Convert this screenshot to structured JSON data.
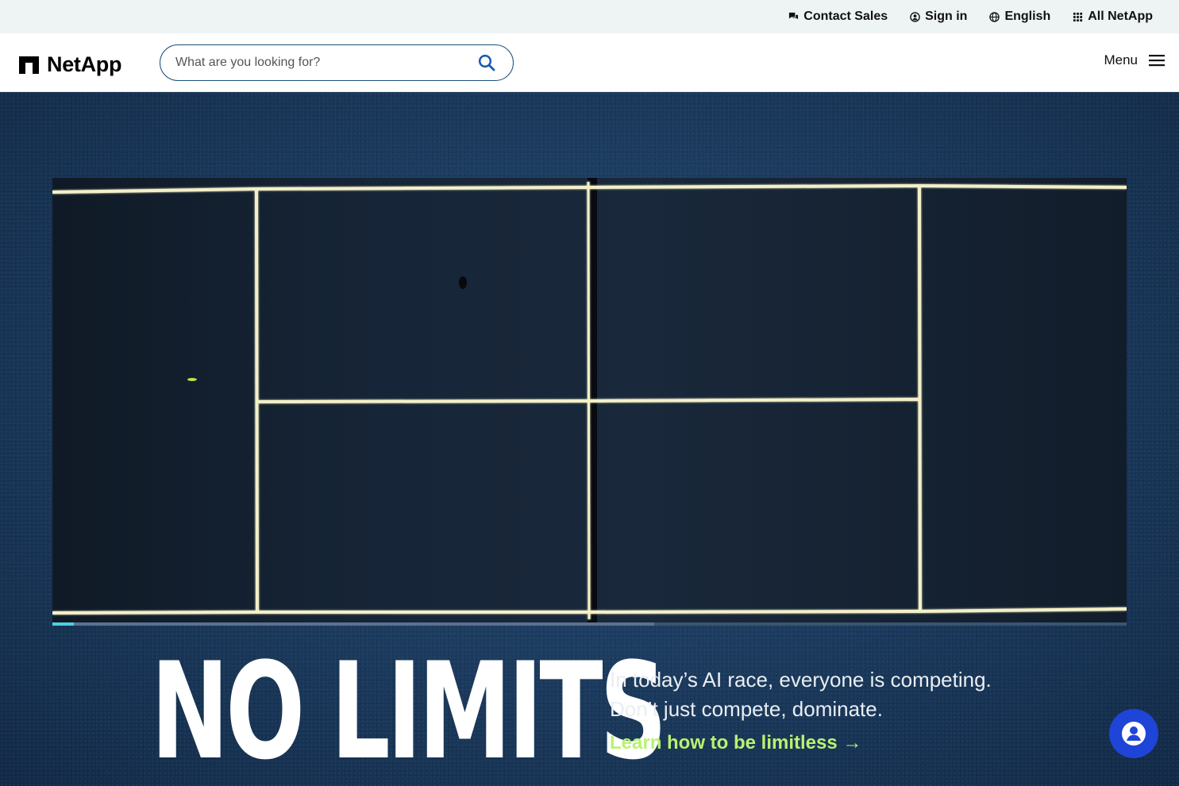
{
  "utility": {
    "contact_sales": "Contact Sales",
    "sign_in": "Sign in",
    "language": "English",
    "all_netapp": "All NetApp"
  },
  "header": {
    "logo_text": "NetApp",
    "search_placeholder": "What are you looking for?",
    "search_value": "",
    "menu_label": "Menu"
  },
  "hero": {
    "headline": "NO LIMITS",
    "tagline_line1": "In today’s AI race, everyone is competing.",
    "tagline_line2": "Don’t just compete, dominate.",
    "cta_label": "Learn how to be limitless →",
    "video_progress_fraction": 0.02,
    "video_buffered_fraction": 0.56
  },
  "colors": {
    "accent_cta": "#b9f271",
    "progress": "#4ed0e0",
    "chat_button": "#1e44d8",
    "search_border": "#1b4f7a"
  },
  "icons": [
    "chat-bubble-icon",
    "user-circle-icon",
    "globe-icon",
    "grid-icon",
    "netapp-logo-icon",
    "search-icon",
    "hamburger-menu-icon",
    "chat-assistant-icon"
  ]
}
